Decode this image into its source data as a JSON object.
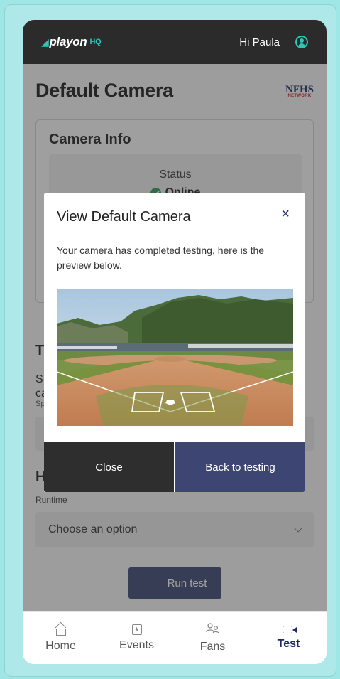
{
  "header": {
    "logo_text": "playon",
    "logo_suffix": "HQ",
    "greeting": "Hi Paula"
  },
  "page": {
    "title": "Default Camera",
    "partner_logo": "NFHS",
    "partner_logo_sub": "NETWORK"
  },
  "camera_info": {
    "heading": "Camera Info",
    "status_label": "Status",
    "status_value": "Online"
  },
  "background_form": {
    "section_t": "T",
    "section_s": "S\nca",
    "sp_label": "Sp",
    "section_h": "H",
    "runtime_label": "Runtime",
    "runtime_select": "Choose an option",
    "run_button": "Run test"
  },
  "modal": {
    "title": "View Default Camera",
    "close_icon": "×",
    "body": "Your camera has completed testing, here is the preview below.",
    "close_button": "Close",
    "back_button": "Back to testing"
  },
  "bottom_nav": {
    "items": [
      {
        "label": "Home",
        "icon": "home-icon"
      },
      {
        "label": "Events",
        "icon": "events-icon"
      },
      {
        "label": "Fans",
        "icon": "fans-icon"
      },
      {
        "label": "Test",
        "icon": "video-camera-icon",
        "active": true
      }
    ]
  },
  "colors": {
    "topbar": "#2b2b2b",
    "accent": "#2ec4b6",
    "primary_button": "#3d4573",
    "dark_button": "#2e2e2e",
    "status_online": "#2e9c5e"
  }
}
